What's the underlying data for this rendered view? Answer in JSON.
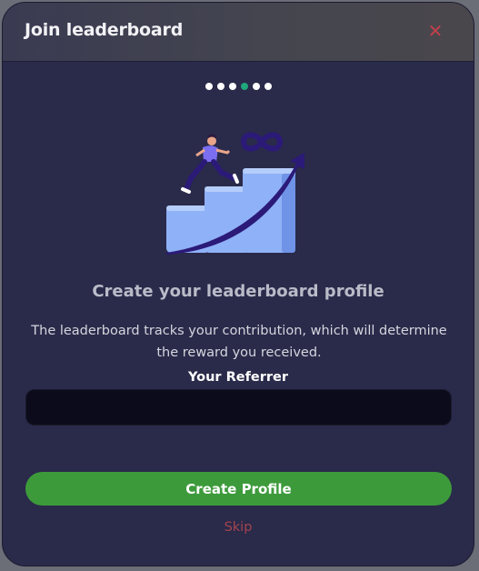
{
  "modal": {
    "title": "Join leaderboard",
    "close_icon": "close-icon"
  },
  "progress": {
    "total_steps": 6,
    "current_step": 4,
    "active_color": "#1fa67a",
    "inactive_color": "#ffffff"
  },
  "illustration": {
    "icon": "growth-chart-runner-icon"
  },
  "content": {
    "headline": "Create your leaderboard profile",
    "description": "The leaderboard tracks your contribution, which will determine the reward you received."
  },
  "referrer": {
    "label": "Your Referrer",
    "value": "",
    "placeholder": ""
  },
  "actions": {
    "create_label": "Create Profile",
    "skip_label": "Skip"
  },
  "colors": {
    "background": "#2a2a4a",
    "primary_button": "#3d9a3b",
    "skip_text": "#a4444e",
    "close_icon": "#c0404a"
  }
}
